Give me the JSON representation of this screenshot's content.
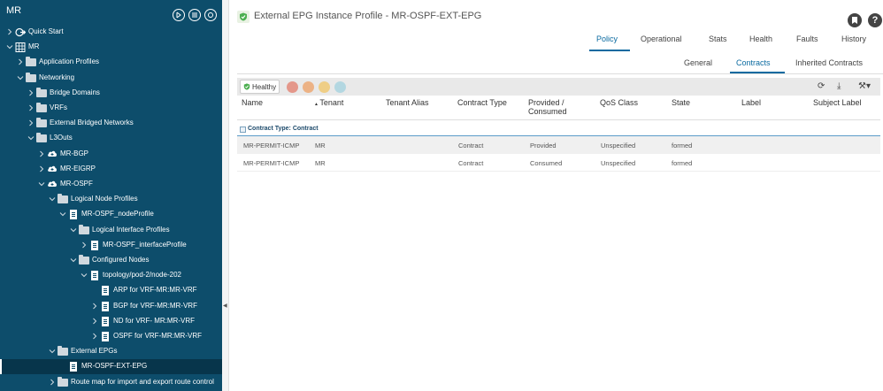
{
  "app": {
    "title": "MR"
  },
  "sidebar": {
    "tree": [
      {
        "label": "Quick Start",
        "depth": 0,
        "icon": "quickstart-icon",
        "toggle": "collapsed"
      },
      {
        "label": "MR",
        "depth": 0,
        "icon": "tenant-icon",
        "toggle": "expanded"
      },
      {
        "label": "Application Profiles",
        "depth": 1,
        "icon": "folder-icon",
        "toggle": "collapsed"
      },
      {
        "label": "Networking",
        "depth": 1,
        "icon": "folder-icon",
        "toggle": "expanded"
      },
      {
        "label": "Bridge Domains",
        "depth": 2,
        "icon": "folder-icon",
        "toggle": "collapsed"
      },
      {
        "label": "VRFs",
        "depth": 2,
        "icon": "folder-icon",
        "toggle": "collapsed"
      },
      {
        "label": "External Bridged Networks",
        "depth": 2,
        "icon": "folder-icon",
        "toggle": "collapsed"
      },
      {
        "label": "L3Outs",
        "depth": 2,
        "icon": "folder-icon",
        "toggle": "expanded"
      },
      {
        "label": "MR-BGP",
        "depth": 3,
        "icon": "cloud-icon",
        "toggle": "collapsed"
      },
      {
        "label": "MR-EIGRP",
        "depth": 3,
        "icon": "cloud-icon",
        "toggle": "collapsed"
      },
      {
        "label": "MR-OSPF",
        "depth": 3,
        "icon": "cloud-icon",
        "toggle": "expanded"
      },
      {
        "label": "Logical Node Profiles",
        "depth": 4,
        "icon": "folder-icon",
        "toggle": "expanded"
      },
      {
        "label": "MR-OSPF_nodeProfile",
        "depth": 5,
        "icon": "document-icon",
        "toggle": "expanded"
      },
      {
        "label": "Logical Interface Profiles",
        "depth": 6,
        "icon": "folder-icon",
        "toggle": "expanded"
      },
      {
        "label": "MR-OSPF_interfaceProfile",
        "depth": 7,
        "icon": "document-icon",
        "toggle": "collapsed"
      },
      {
        "label": "Configured Nodes",
        "depth": 6,
        "icon": "folder-icon",
        "toggle": "expanded"
      },
      {
        "label": "topology/pod-2/node-202",
        "depth": 7,
        "icon": "document-icon",
        "toggle": "expanded"
      },
      {
        "label": "ARP for VRF-MR:MR-VRF",
        "depth": 8,
        "icon": "document-icon",
        "toggle": "none"
      },
      {
        "label": "BGP for VRF-MR:MR-VRF",
        "depth": 8,
        "icon": "document-icon",
        "toggle": "collapsed"
      },
      {
        "label": "ND for VRF- MR:MR-VRF",
        "depth": 8,
        "icon": "document-icon",
        "toggle": "collapsed"
      },
      {
        "label": "OSPF for VRF-MR:MR-VRF",
        "depth": 8,
        "icon": "document-icon",
        "toggle": "collapsed"
      },
      {
        "label": "External EPGs",
        "depth": 4,
        "icon": "folder-icon",
        "toggle": "expanded"
      },
      {
        "label": "MR-OSPF-EXT-EPG",
        "depth": 5,
        "icon": "document-icon",
        "toggle": "none",
        "selected": true
      },
      {
        "label": "Route map for import and export route control",
        "depth": 4,
        "icon": "folder-icon",
        "toggle": "collapsed"
      }
    ]
  },
  "main": {
    "title": "External EPG Instance Profile - MR-OSPF-EXT-EPG",
    "tabs": [
      "Policy",
      "Operational",
      "Stats",
      "Health",
      "Faults",
      "History"
    ],
    "active_tab": "Policy",
    "subtabs": [
      "General",
      "Contracts",
      "Inherited Contracts"
    ],
    "active_subtab": "Contracts",
    "toolbar": {
      "health_label": "Healthy",
      "fault_colors": [
        "#e0452b",
        "#f07c22",
        "#f5b324",
        "#7ec6d9"
      ],
      "icons": [
        "refresh-icon",
        "download-icon",
        "tools-icon"
      ]
    },
    "table": {
      "columns": [
        "Name",
        "Tenant",
        "Tenant Alias",
        "Contract Type",
        "Provided / Consumed",
        "QoS Class",
        "State",
        "Label",
        "Subject Label"
      ],
      "sorted_column": "Tenant",
      "group_label": "Contract Type: Contract",
      "rows": [
        [
          "MR-PERMIT-ICMP",
          "MR",
          "",
          "Contract",
          "Provided",
          "Unspecified",
          "formed",
          "",
          ""
        ],
        [
          "MR-PERMIT-ICMP",
          "MR",
          "",
          "Contract",
          "Consumed",
          "Unspecified",
          "formed",
          "",
          ""
        ]
      ]
    }
  }
}
